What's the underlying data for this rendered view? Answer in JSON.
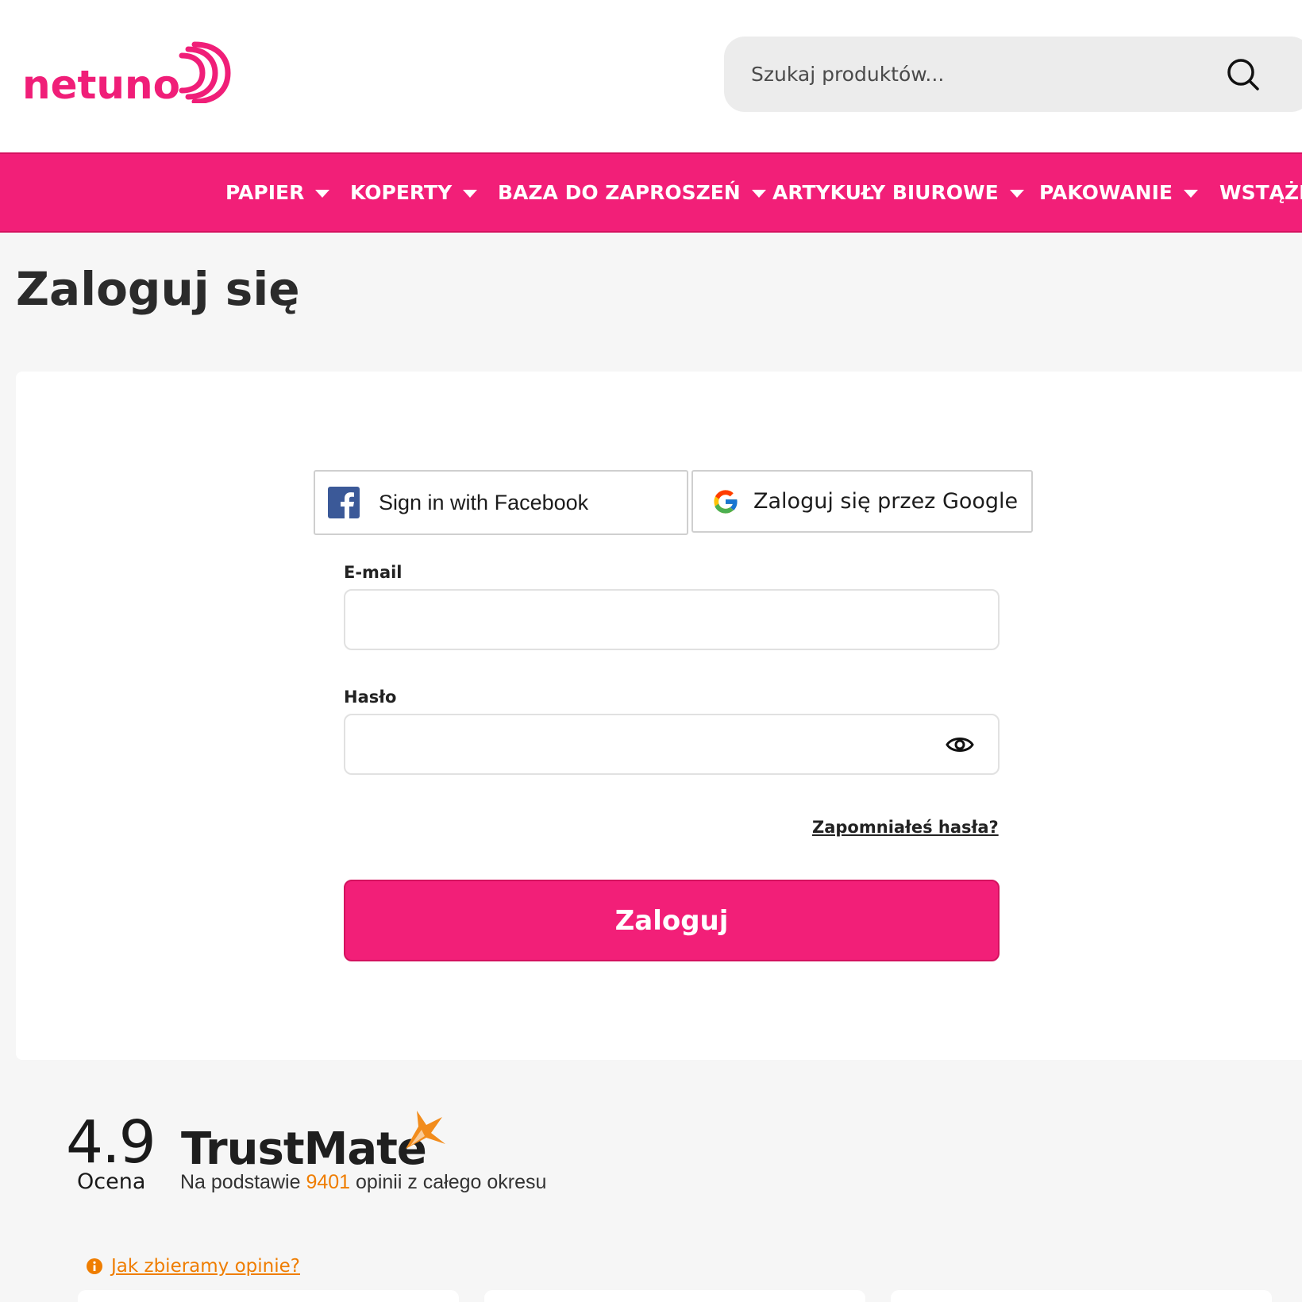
{
  "header": {
    "logo_text": "netuno",
    "search": {
      "placeholder": "Szukaj produktów..."
    }
  },
  "nav": {
    "items": [
      {
        "label": "PAPIER"
      },
      {
        "label": "KOPERTY"
      },
      {
        "label": "BAZA DO ZAPROSZEŃ"
      },
      {
        "label": "ARTYKUŁY BIUROWE"
      },
      {
        "label": "PAKOWANIE"
      },
      {
        "label": "WSTĄŻKI"
      }
    ]
  },
  "page": {
    "title": "Zaloguj się"
  },
  "login": {
    "facebook_label": "Sign in with Facebook",
    "google_label": "Zaloguj się przez Google",
    "email_label": "E-mail",
    "password_label": "Hasło",
    "forgot_label": "Zapomniałeś hasła?",
    "submit_label": "Zaloguj"
  },
  "trustmate": {
    "rating": "4.9",
    "rating_label": "Ocena",
    "brand": "TrustMate",
    "sub_prefix": "Na podstawie ",
    "review_count": "9401",
    "sub_suffix": " opinii z całego okresu",
    "info_link": "Jak zbieramy opinie?"
  },
  "colors": {
    "brand_pink": "#f21f78",
    "trustmate_orange": "#ef7d00",
    "facebook_blue": "#3b5998"
  },
  "icons": [
    "logo-waves-icon",
    "search-icon",
    "chevron-down-icon",
    "facebook-icon",
    "google-icon",
    "eye-icon",
    "trustmate-star-icon",
    "info-icon"
  ]
}
